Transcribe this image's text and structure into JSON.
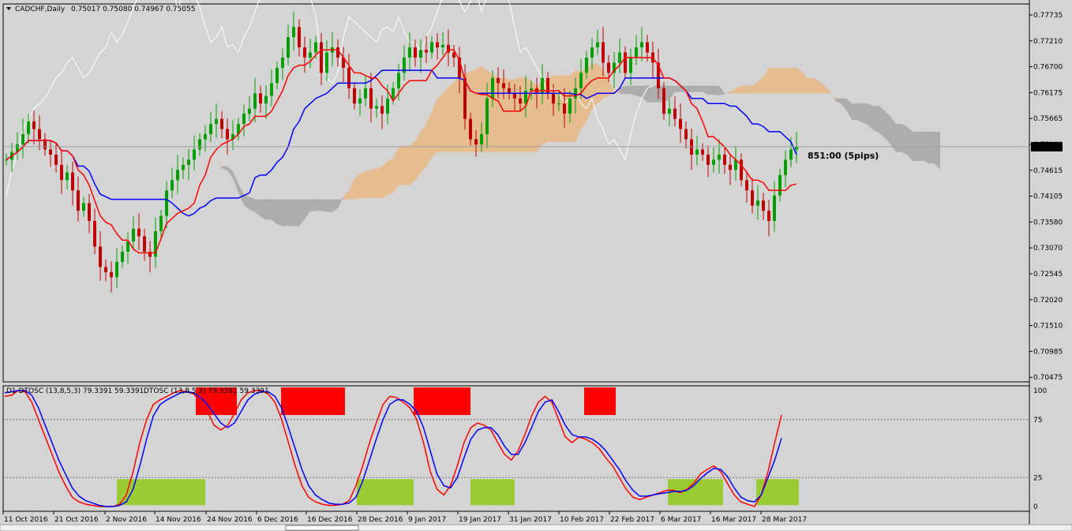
{
  "window": {
    "symbol_title": "CADCHF,Daily",
    "ohlc": "0.75017 0.75080 0.74967 0.75055"
  },
  "oscillator": {
    "title": "D1 DTOSC (13,8,5,3) 79.3391 59.3391",
    "title2": "DTOSC (13,8,5,3) 79.3391 59.3391"
  },
  "annotation": "851:00 (5pips)",
  "colors": {
    "background": "#d4d4d4",
    "bull_candle": "#00a000",
    "bear_candle": "#c00000",
    "tenkan": "#ff0000",
    "kijun": "#0000ff",
    "chikou": "#ffffff",
    "kumo_bull": "#e8b98a",
    "kumo_bear": "#a8a8a8",
    "osc_fast": "#ff0000",
    "osc_slow": "#0000ff",
    "overbought_box": "#ff0000",
    "oversold_box": "#99cc33"
  },
  "chart_data": [
    {
      "type": "candlestick",
      "title": "CADCHF,Daily",
      "ylim": [
        0.7045,
        0.7785
      ],
      "current_price": "0.75055",
      "y_tick_labels": [
        "0.77735",
        "0.77210",
        "0.76700",
        "0.76175",
        "0.75665",
        "0.75140",
        "0.74615",
        "0.74105",
        "0.73580",
        "0.73070",
        "0.72545",
        "0.72020",
        "0.71510",
        "0.70985",
        "0.70475"
      ],
      "x_tick_labels": [
        "11 Oct 2016",
        "21 Oct 2016",
        "2 Nov 2016",
        "14 Nov 2016",
        "24 Nov 2016",
        "6 Dec 2016",
        "16 Dec 2016",
        "28 Dec 2016",
        "9 Jan 2017",
        "19 Jan 2017",
        "31 Jan 2017",
        "10 Feb 2017",
        "22 Feb 2017",
        "6 Mar 2017",
        "16 Mar 2017",
        "28 Mar 2017"
      ],
      "close": [
        0.748,
        0.7495,
        0.751,
        0.753,
        0.7555,
        0.754,
        0.752,
        0.75,
        0.749,
        0.747,
        0.744,
        0.7455,
        0.742,
        0.738,
        0.7395,
        0.736,
        0.731,
        0.727,
        0.726,
        0.725,
        0.728,
        0.73,
        0.732,
        0.7345,
        0.733,
        0.73,
        0.729,
        0.734,
        0.737,
        0.742,
        0.744,
        0.746,
        0.747,
        0.748,
        0.75,
        0.752,
        0.753,
        0.755,
        0.756,
        0.754,
        0.752,
        0.753,
        0.755,
        0.757,
        0.758,
        0.761,
        0.759,
        0.7605,
        0.763,
        0.766,
        0.768,
        0.772,
        0.774,
        0.77,
        0.768,
        0.769,
        0.771,
        0.765,
        0.769,
        0.77,
        0.768,
        0.766,
        0.762,
        0.759,
        0.76,
        0.762,
        0.758,
        0.7585,
        0.757,
        0.76,
        0.762,
        0.765,
        0.768,
        0.77,
        0.768,
        0.7695,
        0.769,
        0.771,
        0.77,
        0.7705,
        0.769,
        0.768,
        0.764,
        0.756,
        0.752,
        0.751,
        0.753,
        0.76,
        0.764,
        0.763,
        0.762,
        0.761,
        0.76,
        0.759,
        0.7615,
        0.762,
        0.761,
        0.764,
        0.761,
        0.759,
        0.759,
        0.757,
        0.76,
        0.762,
        0.765,
        0.768,
        0.77,
        0.771,
        0.767,
        0.765,
        0.767,
        0.769,
        0.765,
        0.768,
        0.77,
        0.771,
        0.769,
        0.767,
        0.762,
        0.757,
        0.758,
        0.756,
        0.754,
        0.752,
        0.749,
        0.75,
        0.749,
        0.747,
        0.748,
        0.749,
        0.747,
        0.746,
        0.748,
        0.744,
        0.742,
        0.739,
        0.74,
        0.738,
        0.736,
        0.741,
        0.745,
        0.748,
        0.75,
        0.7505
      ]
    },
    {
      "type": "line",
      "title": "D1 DTOSC (13,8,5,3) 79.3391 59.3391",
      "ylim": [
        0,
        100
      ],
      "y_tick_labels": [
        "100",
        "75",
        "25",
        "0"
      ],
      "levels": [
        75,
        25
      ],
      "series": [
        {
          "values": [
            95,
            96,
            100,
            99,
            90,
            75,
            60,
            45,
            30,
            18,
            8,
            4,
            2,
            1,
            0,
            0,
            0,
            2,
            10,
            30,
            55,
            75,
            88,
            92,
            95,
            98,
            100,
            99,
            97,
            90,
            82,
            70,
            66,
            70,
            80,
            92,
            98,
            100,
            100,
            97,
            90,
            75,
            55,
            35,
            18,
            8,
            4,
            2,
            1,
            1,
            2,
            5,
            18,
            35,
            55,
            72,
            88,
            95,
            94,
            90,
            85,
            75,
            55,
            30,
            15,
            10,
            18,
            35,
            55,
            68,
            72,
            70,
            66,
            55,
            45,
            40,
            48,
            62,
            78,
            90,
            95,
            90,
            75,
            60,
            55,
            60,
            58,
            55,
            50,
            42,
            35,
            25,
            15,
            8,
            6,
            8,
            10,
            12,
            14,
            14,
            12,
            15,
            20,
            28,
            32,
            35,
            30,
            20,
            10,
            4,
            2,
            0,
            10,
            30,
            55,
            79
          ]
        },
        {
          "values": [
            98,
            99,
            100,
            100,
            96,
            85,
            70,
            55,
            40,
            28,
            16,
            9,
            5,
            3,
            1,
            0,
            0,
            1,
            4,
            15,
            35,
            58,
            78,
            88,
            92,
            95,
            98,
            99,
            98,
            94,
            88,
            80,
            72,
            68,
            72,
            82,
            92,
            97,
            99,
            99,
            95,
            85,
            68,
            50,
            32,
            18,
            10,
            6,
            3,
            2,
            2,
            3,
            8,
            22,
            40,
            58,
            75,
            88,
            92,
            92,
            88,
            82,
            68,
            48,
            28,
            18,
            16,
            25,
            42,
            58,
            66,
            68,
            68,
            62,
            52,
            45,
            45,
            55,
            68,
            82,
            90,
            92,
            82,
            70,
            62,
            60,
            60,
            58,
            54,
            48,
            40,
            32,
            22,
            14,
            9,
            9,
            10,
            11,
            12,
            13,
            13,
            14,
            18,
            24,
            29,
            33,
            32,
            26,
            16,
            8,
            5,
            4,
            10,
            25,
            40,
            59
          ]
        }
      ],
      "overbought_zones": [
        [
          248,
          300
        ],
        [
          356,
          437
        ],
        [
          524,
          596
        ],
        [
          740,
          780
        ]
      ],
      "oversold_zones": [
        [
          148,
          260
        ],
        [
          452,
          524
        ],
        [
          596,
          652
        ],
        [
          846,
          916
        ],
        [
          958,
          1012
        ]
      ]
    }
  ]
}
